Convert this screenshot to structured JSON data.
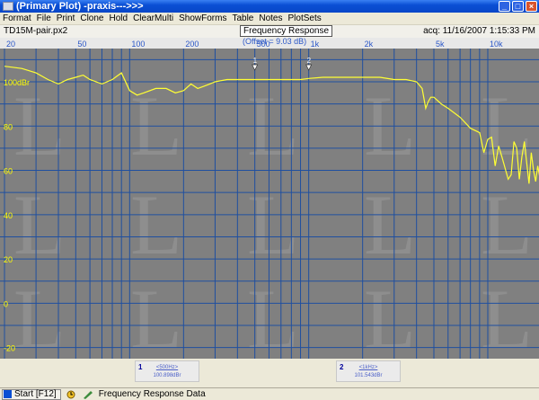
{
  "window": {
    "title": "(Primary Plot) -praxis--->>>"
  },
  "menu": [
    "Format",
    "File",
    "Print",
    "Clone",
    "Hold",
    "ClearMulti",
    "ShowForms",
    "Table",
    "Notes",
    "PlotSets"
  ],
  "info": {
    "filename": "TD15M-pair.px2",
    "plot_title": "Frequency Response",
    "acq": "acq: 11/16/2007 1:15:33 PM",
    "offset": "(Offset = 9.03 dB)"
  },
  "markers": [
    {
      "num": "1",
      "freq": "<500Hz>",
      "level": "100.898dBr",
      "x": 500
    },
    {
      "num": "2",
      "freq": "<1kHz>",
      "level": "101.543dBr",
      "x": 1000
    }
  ],
  "status": {
    "start": "Start [F12]",
    "text": "Frequency Response Data"
  },
  "colors": {
    "trace": "#ffff33",
    "grid": "#1f4fa0",
    "plot_bg": "#808080",
    "label": "#ffff00",
    "freq_label": "#2b57c8"
  },
  "chart_data": {
    "type": "line",
    "title": "Frequency Response",
    "xscale": "log",
    "xlim": [
      20,
      20000
    ],
    "ylim": [
      -25,
      115
    ],
    "x_tick_labels": [
      {
        "v": 20,
        "t": "20"
      },
      {
        "v": 50,
        "t": "50"
      },
      {
        "v": 100,
        "t": "100"
      },
      {
        "v": 200,
        "t": "200"
      },
      {
        "v": 500,
        "t": "500"
      },
      {
        "v": 1000,
        "t": "1k"
      },
      {
        "v": 2000,
        "t": "2k"
      },
      {
        "v": 5000,
        "t": "5k"
      },
      {
        "v": 10000,
        "t": "10k"
      }
    ],
    "y_tick_labels": [
      {
        "v": 100,
        "t": "100dBr"
      },
      {
        "v": 80,
        "t": "80"
      },
      {
        "v": 60,
        "t": "60"
      },
      {
        "v": 40,
        "t": "40"
      },
      {
        "v": 20,
        "t": "20"
      },
      {
        "v": 0,
        "t": "0"
      },
      {
        "v": -20,
        "t": "-20"
      }
    ],
    "series": [
      {
        "x": [
          20,
          25,
          30,
          35,
          40,
          45,
          50,
          55,
          60,
          70,
          80,
          90,
          100,
          110,
          120,
          140,
          160,
          180,
          200,
          220,
          240,
          260,
          280,
          300,
          350,
          400,
          450,
          500,
          600,
          700,
          800,
          900,
          1000,
          1200,
          1500,
          2000,
          2500,
          3000,
          3500,
          4000,
          4300,
          4500,
          4650,
          4800,
          5000,
          5500,
          6000,
          7000,
          8000,
          9000,
          9500,
          10000,
          10500,
          11000,
          11500,
          12000,
          13000,
          13500,
          14000,
          14500,
          15000,
          15500,
          16000,
          17000,
          17500,
          18000,
          18500,
          19000,
          20000
        ],
        "y": [
          107,
          106,
          104,
          101,
          99,
          101,
          102,
          103,
          101,
          99,
          101,
          104,
          96,
          94,
          95,
          97,
          97,
          95,
          96,
          99,
          97,
          98,
          99,
          100,
          101,
          101,
          101,
          101,
          101,
          101,
          101,
          101,
          101.5,
          102,
          102,
          102,
          102,
          101,
          101,
          100,
          97,
          88,
          91,
          93,
          93,
          90,
          88,
          84,
          79,
          77,
          68,
          74,
          75,
          62,
          71,
          66,
          56,
          58,
          73,
          70,
          56,
          66,
          73,
          54,
          68,
          60,
          55,
          62,
          52
        ]
      }
    ]
  }
}
